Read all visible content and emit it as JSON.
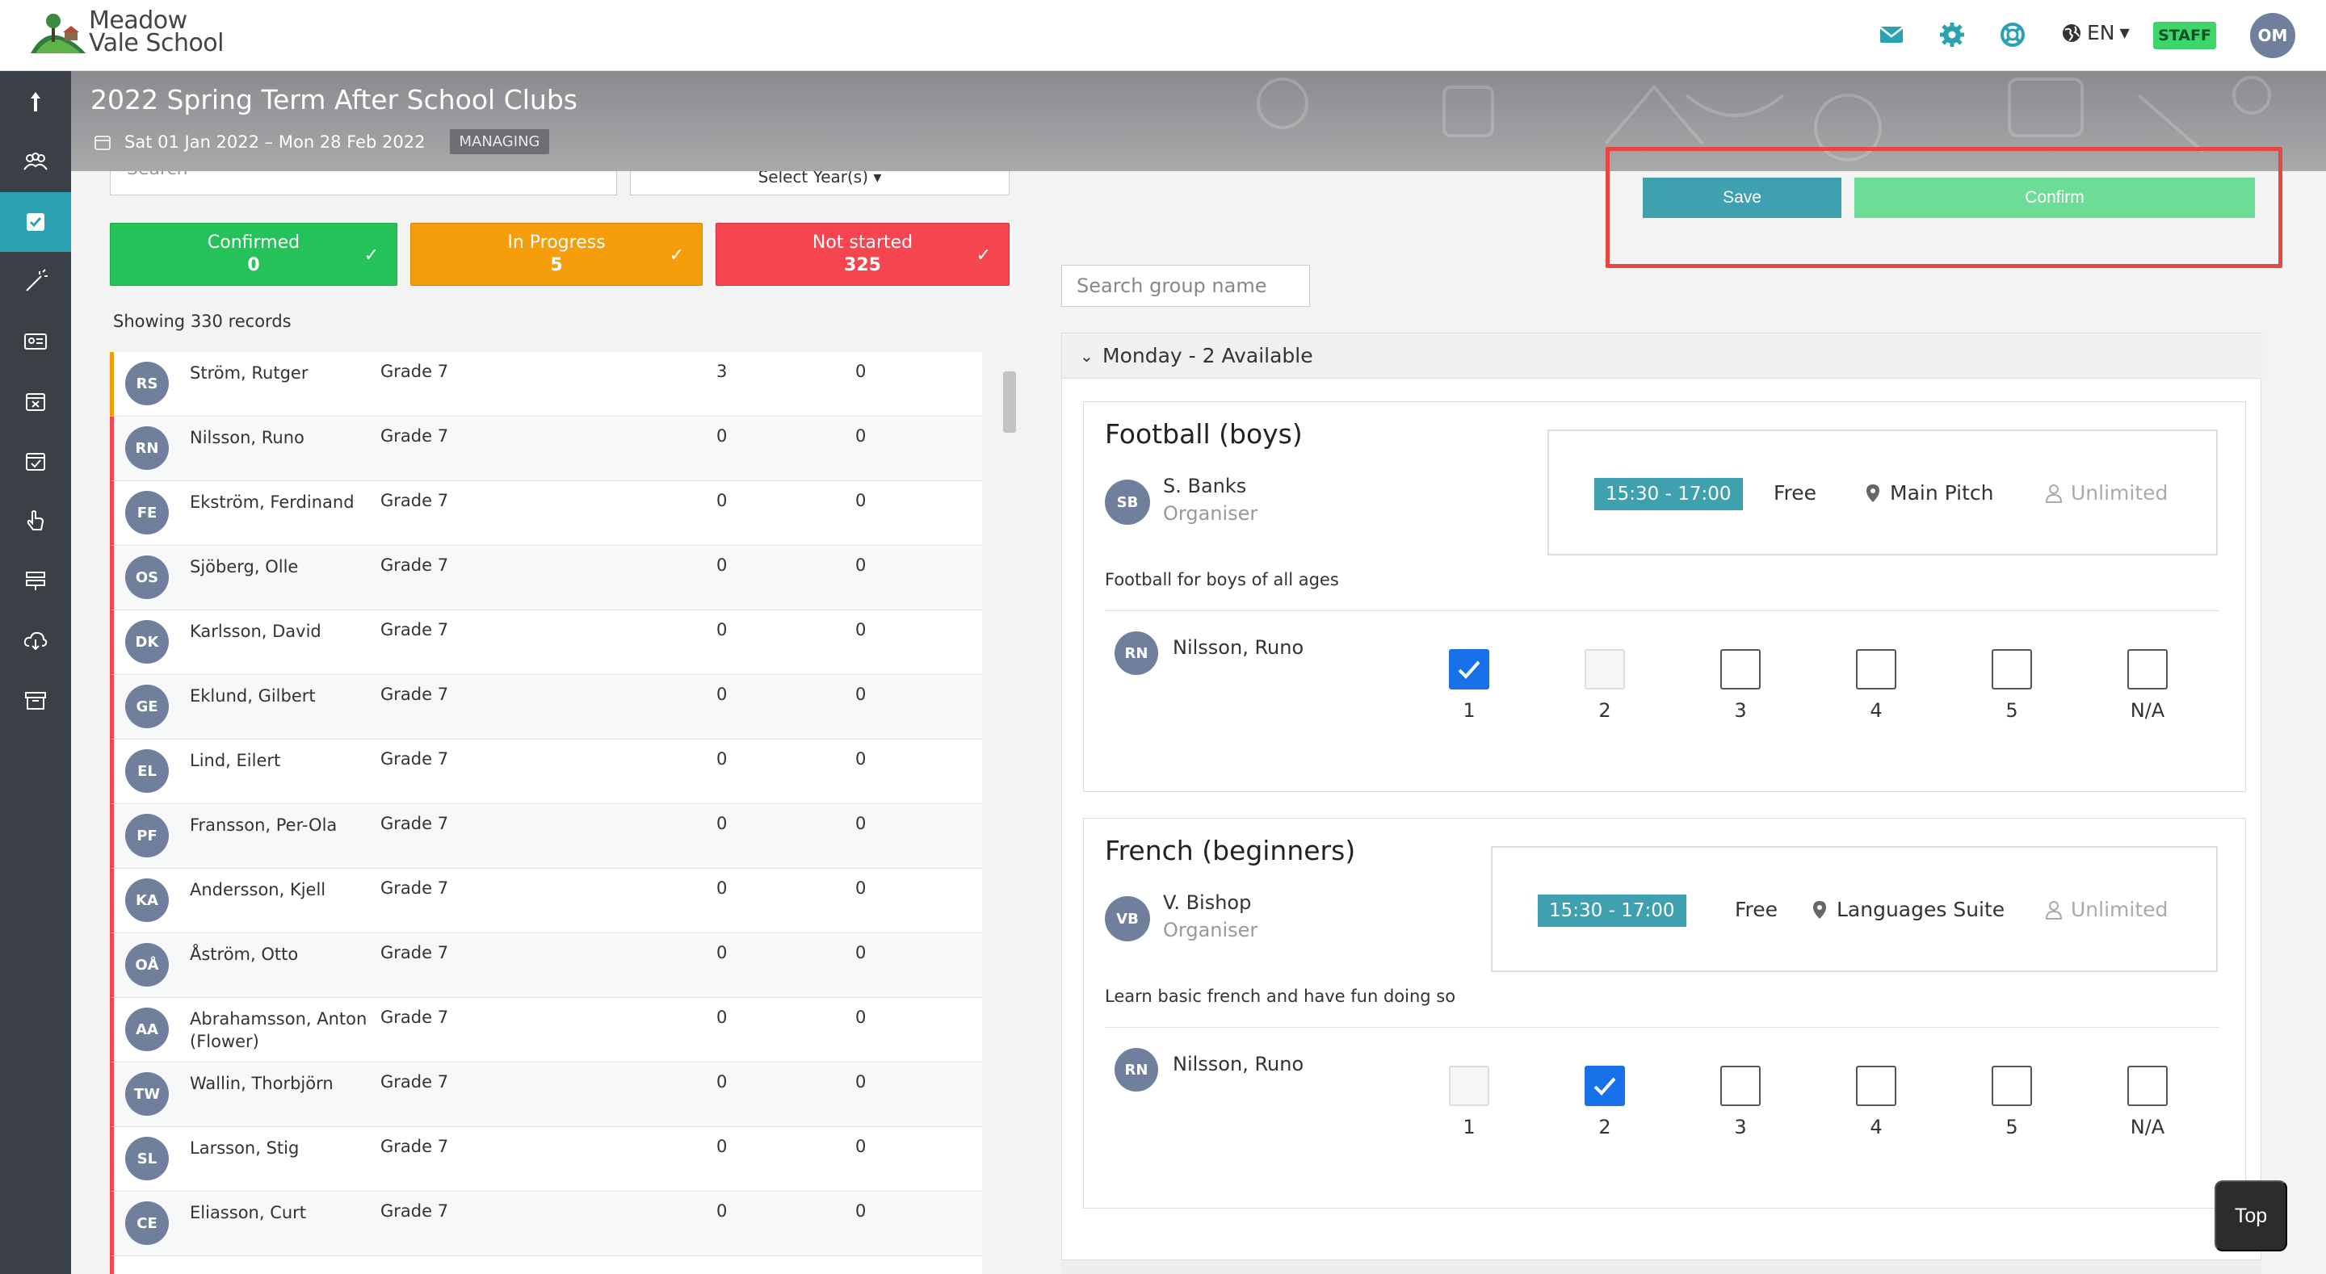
{
  "app": {
    "logo_line1": "Meadow",
    "logo_line2": "Vale School",
    "language": "EN",
    "role_badge": "STAFF",
    "user_initials": "OM"
  },
  "banner": {
    "title": "2022 Spring Term After School Clubs",
    "date_range": "Sat 01 Jan 2022 – Mon 28 Feb 2022",
    "badge": "MANAGING"
  },
  "filters": {
    "search_placeholder": "Search",
    "year_select": "Select Year(s) ▾"
  },
  "stats": {
    "confirmed_label": "Confirmed",
    "confirmed_count": "0",
    "progress_label": "In Progress",
    "progress_count": "5",
    "notstarted_label": "Not started",
    "notstarted_count": "325"
  },
  "records_text": "Showing 330 records",
  "students": [
    {
      "initials": "RS",
      "name": "Ström, Rutger",
      "grade": "Grade 7",
      "c1": "3",
      "c2": "0"
    },
    {
      "initials": "RN",
      "name": "Nilsson, Runo",
      "grade": "Grade 7",
      "c1": "0",
      "c2": "0"
    },
    {
      "initials": "FE",
      "name": "Ekström, Ferdinand",
      "grade": "Grade 7",
      "c1": "0",
      "c2": "0"
    },
    {
      "initials": "OS",
      "name": "Sjöberg, Olle",
      "grade": "Grade 7",
      "c1": "0",
      "c2": "0"
    },
    {
      "initials": "DK",
      "name": "Karlsson, David",
      "grade": "Grade 7",
      "c1": "0",
      "c2": "0"
    },
    {
      "initials": "GE",
      "name": "Eklund, Gilbert",
      "grade": "Grade 7",
      "c1": "0",
      "c2": "0"
    },
    {
      "initials": "EL",
      "name": "Lind, Eilert",
      "grade": "Grade 7",
      "c1": "0",
      "c2": "0"
    },
    {
      "initials": "PF",
      "name": "Fransson, Per-Ola",
      "grade": "Grade 7",
      "c1": "0",
      "c2": "0"
    },
    {
      "initials": "KA",
      "name": "Andersson, Kjell",
      "grade": "Grade 7",
      "c1": "0",
      "c2": "0"
    },
    {
      "initials": "OÅ",
      "name": "Åström, Otto",
      "grade": "Grade 7",
      "c1": "0",
      "c2": "0"
    },
    {
      "initials": "AA",
      "name": "Abrahamsson, Anton (Flower)",
      "grade": "Grade 7",
      "c1": "0",
      "c2": "0"
    },
    {
      "initials": "TW",
      "name": "Wallin, Thorbjörn",
      "grade": "Grade 7",
      "c1": "0",
      "c2": "0"
    },
    {
      "initials": "SL",
      "name": "Larsson, Stig",
      "grade": "Grade 7",
      "c1": "0",
      "c2": "0"
    },
    {
      "initials": "CE",
      "name": "Eliasson, Curt",
      "grade": "Grade 7",
      "c1": "0",
      "c2": "0"
    }
  ],
  "actions": {
    "save": "Save",
    "confirm": "Confirm",
    "group_search_placeholder": "Search group name"
  },
  "day": {
    "header": "Monday - 2 Available"
  },
  "clubs": [
    {
      "title": "Football (boys)",
      "organiser_initials": "SB",
      "organiser_name": "S. Banks",
      "organiser_role": "Organiser",
      "time": "15:30 - 17:00",
      "fee": "Free",
      "location": "Main Pitch",
      "capacity": "Unlimited",
      "description": "Football for boys of all ages",
      "student_initials": "RN",
      "student_name": "Nilsson, Runo",
      "prefs": [
        "1",
        "2",
        "3",
        "4",
        "5",
        "N/A"
      ]
    },
    {
      "title": "French (beginners)",
      "organiser_initials": "VB",
      "organiser_name": "V. Bishop",
      "organiser_role": "Organiser",
      "time": "15:30 - 17:00",
      "fee": "Free",
      "location": "Languages Suite",
      "capacity": "Unlimited",
      "description": "Learn basic french and have fun doing so",
      "student_initials": "RN",
      "student_name": "Nilsson, Runo",
      "prefs": [
        "1",
        "2",
        "3",
        "4",
        "5",
        "N/A"
      ]
    }
  ],
  "top_button": "Top",
  "colors": {
    "accent": "#3fa0af",
    "confirmed": "#25c25a",
    "in_progress": "#f59d0b",
    "not_started": "#f5454f",
    "highlight": "#e8473f"
  }
}
